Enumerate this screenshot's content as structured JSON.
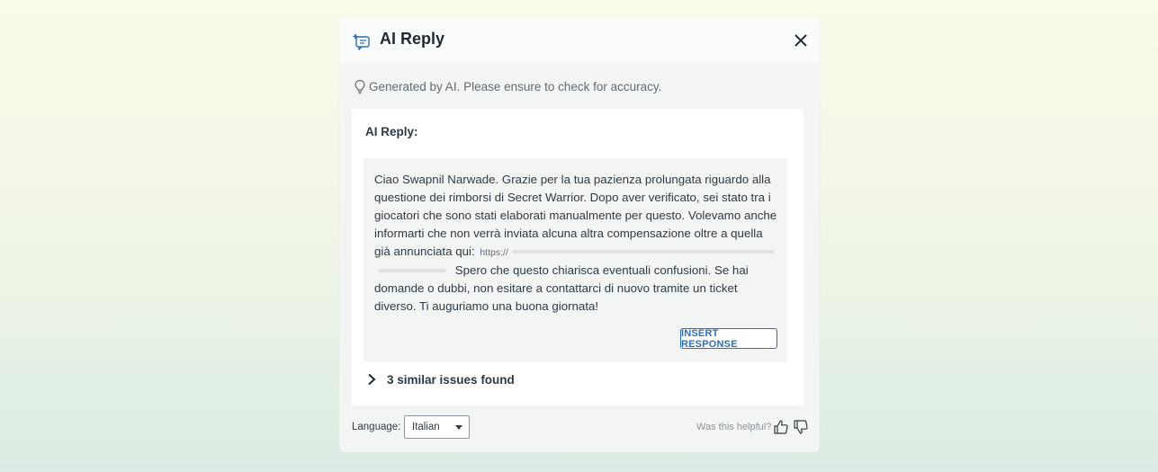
{
  "header": {
    "title": "AI Reply",
    "icon": "ai-chat-sparkle-icon",
    "close_icon": "close-icon"
  },
  "notice": {
    "icon": "lightbulb-icon",
    "text": "Generated by AI. Please ensure to check for accuracy."
  },
  "reply": {
    "label": "AI Reply:",
    "text_part1": "Ciao Swapnil Narwade. Grazie per la tua pazienza prolungata riguardo alla questione dei rimborsi di Secret Warrior. Dopo aver verificato, sei stato tra i giocatori che sono stati elaborati manualmente per questo. Volevamo anche informarti che non verrà inviata alcuna altra compensazione oltre a quella già annunciata qui:",
    "url_prefix": "https://",
    "text_part2": "Spero che questo chiarisca eventuali confusioni. Se hai domande o dubbi, non esitare a contattarci di nuovo tramite un ticket diverso. Ti auguriamo una buona giornata!",
    "insert_button": "INSERT RESPONSE"
  },
  "similar": {
    "icon": "chevron-right-icon",
    "label": "3 similar issues found"
  },
  "footer": {
    "language_label": "Language:",
    "language_value": "Italian",
    "helpful_text": "Was this helpful?",
    "thumbs_up_icon": "thumbs-up-icon",
    "thumbs_down_icon": "thumbs-down-icon"
  },
  "colors": {
    "accent": "#2f6fb3",
    "text": "#2e3a43",
    "panel": "#f3f5f4"
  }
}
